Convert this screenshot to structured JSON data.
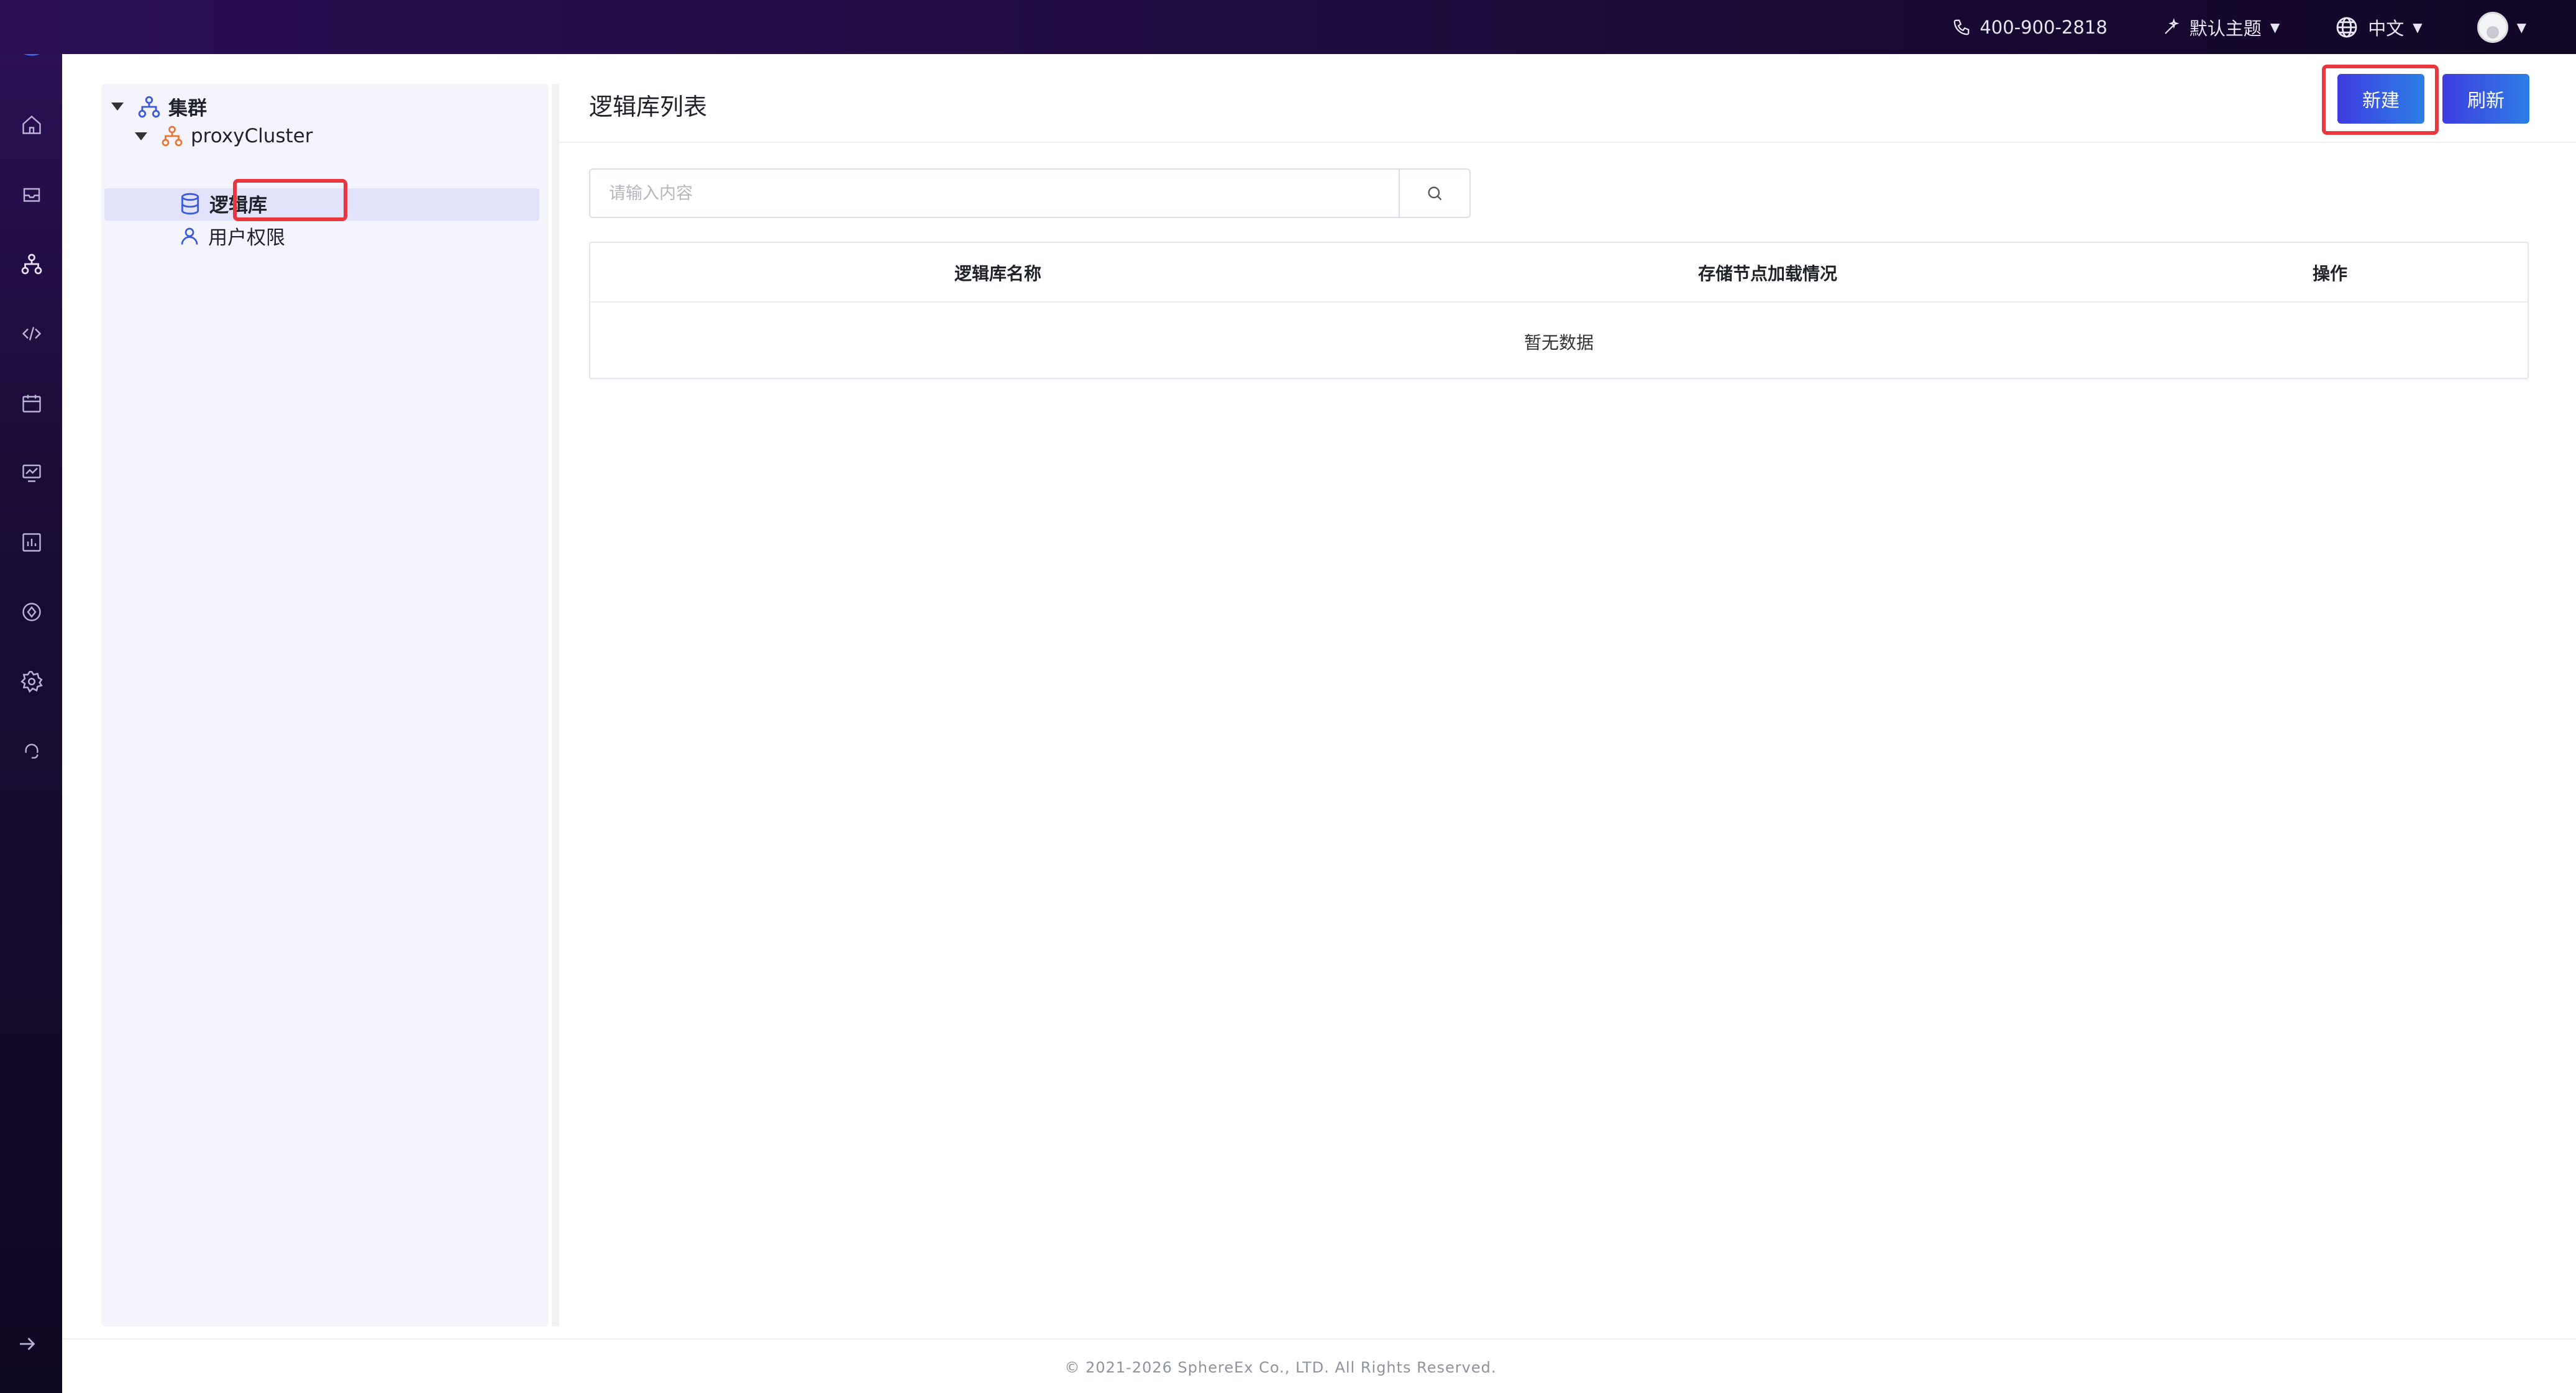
{
  "topbar": {
    "phone": "400-900-2818",
    "theme_label": "默认主题",
    "language_label": "中文"
  },
  "sidebar": {
    "icons": [
      "home-icon",
      "inbox-icon",
      "cluster-icon",
      "code-icon",
      "calendar-icon",
      "monitor-icon",
      "report-icon",
      "plugin-icon",
      "settings-icon",
      "support-icon"
    ]
  },
  "tree": {
    "root_label": "集群",
    "cluster_label": "proxyCluster",
    "items": [
      {
        "label": "逻辑库",
        "icon": "database-icon",
        "selected": true
      },
      {
        "label": "用户权限",
        "icon": "user-icon",
        "selected": false
      }
    ]
  },
  "main": {
    "title": "逻辑库列表",
    "new_button": "新建",
    "refresh_button": "刷新",
    "search_placeholder": "请输入内容",
    "table": {
      "columns": [
        "逻辑库名称",
        "存储节点加载情况",
        "操作"
      ],
      "empty_text": "暂无数据"
    }
  },
  "footer": {
    "copyright": "© 2021-2026 SphereEx Co., LTD. All Rights Reserved."
  },
  "colors": {
    "accent": "#3f3be0",
    "highlight": "#e8383d",
    "header_bg": "#1d0b3d"
  }
}
